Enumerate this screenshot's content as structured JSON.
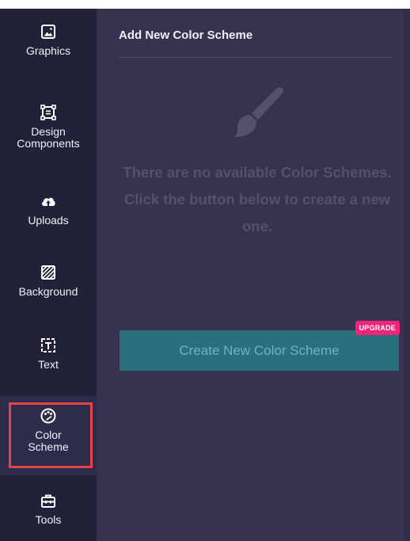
{
  "sidebar": {
    "items": [
      {
        "label": "Graphics",
        "icon": "image-icon"
      },
      {
        "label": "Design\nComponents",
        "icon": "components-icon"
      },
      {
        "label": "Uploads",
        "icon": "cloud-upload-icon"
      },
      {
        "label": "Background",
        "icon": "hatch-background-icon"
      },
      {
        "label": "Text",
        "icon": "text-box-icon"
      },
      {
        "label": "Color\nScheme",
        "icon": "palette-icon"
      },
      {
        "label": "Tools",
        "icon": "toolbox-icon"
      }
    ],
    "active_index": 5
  },
  "panel": {
    "title": "Add New Color Scheme",
    "empty_message": "There are no available Color Schemes. Click the button below to create a new one.",
    "create_button_label": "Create New Color Scheme",
    "upgrade_badge": "UPGRADE",
    "brush_icon": "paint-brush-icon"
  },
  "colors": {
    "sidebar_bg": "#23213a",
    "panel_bg": "#36324f",
    "button_bg": "#2a6f7e",
    "badge_bg": "#f2237a",
    "highlight": "#e64545"
  }
}
